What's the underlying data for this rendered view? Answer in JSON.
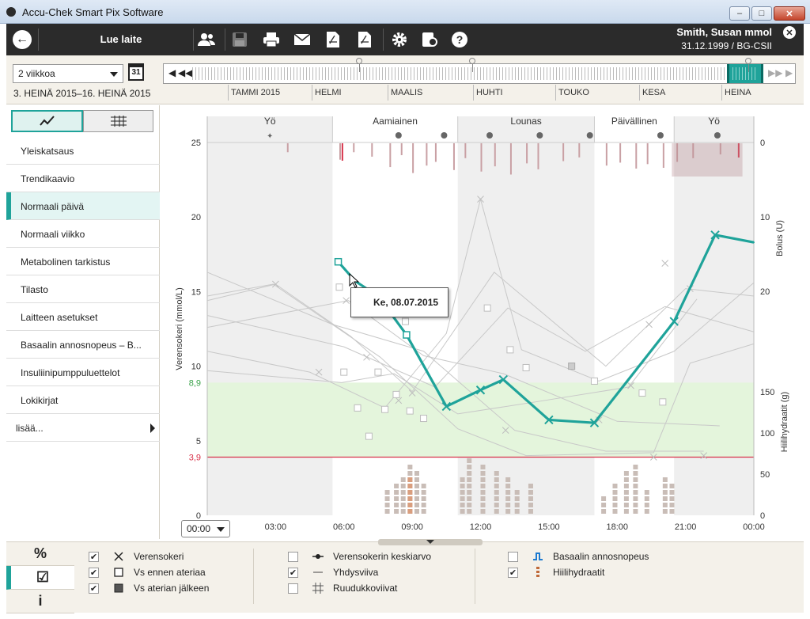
{
  "window": {
    "title": "Accu-Chek Smart Pix Software"
  },
  "toolbar": {
    "title": "Lue laite",
    "user_name": "Smith, Susan mmol",
    "user_sub": "31.12.1999 / BG-CSII",
    "icons": [
      "back-icon",
      "users-icon",
      "save-icon",
      "print-icon",
      "mail-icon",
      "pdf-icon",
      "pdf-export-icon",
      "gear-icon",
      "device-settings-icon",
      "help-icon",
      "close-icon"
    ]
  },
  "period": {
    "selected": "2 viikkoa",
    "calendar_day": "31",
    "range": "3. HEINÄ 2015–16. HEINÄ 2015",
    "months": [
      "TAMMI 2015",
      "HELMI",
      "MAALIS",
      "HUHTI",
      "TOUKO",
      "KESA",
      "HEINA"
    ]
  },
  "sidebar": {
    "items": [
      {
        "label": "Yleiskatsaus"
      },
      {
        "label": "Trendikaavio"
      },
      {
        "label": "Normaali päivä",
        "active": true
      },
      {
        "label": "Normaali viikko"
      },
      {
        "label": "Metabolinen tarkistus"
      },
      {
        "label": "Tilasto"
      },
      {
        "label": "Laitteen asetukset"
      },
      {
        "label": "Basaalin annosnopeus – B..."
      },
      {
        "label": "Insuliinipumppuluettelot"
      },
      {
        "label": "Lokikirjat"
      }
    ],
    "more": "lisää..."
  },
  "chart": {
    "time_select": "00:00",
    "tooltip": "Ke, 08.07.2015",
    "periods": [
      "Yö",
      "Aamiainen",
      "Lounas",
      "Päivällinen",
      "Yö"
    ],
    "target_upper_label": "8,9",
    "target_lower_label": "3,9",
    "colors": {
      "accent": "#1fa39a",
      "hypo": "#d8334a",
      "target_band": "#e4f5dc",
      "target_upper_text": "#3aa24a"
    }
  },
  "chart_data": {
    "type": "line",
    "ylabel": "Verensokeri (mmol/L)",
    "y2label_top": "Bolus (U)",
    "y2label_bottom": "Hiilihydraatit (g)",
    "ylim": [
      0,
      25
    ],
    "yticks": [
      "25",
      "20",
      "15",
      "10",
      "5",
      "0"
    ],
    "xlim": [
      0,
      24
    ],
    "xticks": [
      "03:00",
      "06:00",
      "09:00",
      "12:00",
      "15:00",
      "18:00",
      "21:00",
      "00:00"
    ],
    "bolus_ticks": [
      "0",
      "10",
      "20"
    ],
    "carb_ticks": [
      "150",
      "100",
      "50",
      "0"
    ],
    "target_range": [
      3.9,
      8.9
    ],
    "grid": false,
    "series": [
      {
        "x": [
          5.75,
          6.5,
          7.5,
          8.75,
          10.5,
          12.0,
          13.0,
          15.0,
          17.0,
          20.5,
          22.3,
          24.0
        ],
        "y": [
          17.0,
          15.7,
          14.7,
          12.1,
          7.3,
          8.4,
          9.1,
          6.4,
          6.2,
          13.0,
          18.8,
          18.3
        ]
      }
    ]
  },
  "legend": {
    "tabs": [
      "%",
      "☑",
      "i"
    ],
    "col1": [
      {
        "label": "Verensokeri",
        "checked": true,
        "symbol": "cross"
      },
      {
        "label": "Vs ennen ateriaa",
        "checked": true,
        "symbol": "square-open"
      },
      {
        "label": "Vs aterian jälkeen",
        "checked": true,
        "symbol": "square-filled"
      }
    ],
    "col2": [
      {
        "label": "Verensokerin keskiarvo",
        "checked": false,
        "symbol": "mean-line"
      },
      {
        "label": "Yhdysviiva",
        "checked": true,
        "symbol": "line"
      },
      {
        "label": "Ruudukkoviivat",
        "checked": false,
        "symbol": "grid"
      }
    ],
    "col3": [
      {
        "label": "Basaalin annosnopeus",
        "checked": false,
        "symbol": "basal"
      },
      {
        "label": "Hiilihydraatit",
        "checked": true,
        "symbol": "carbs"
      }
    ]
  }
}
